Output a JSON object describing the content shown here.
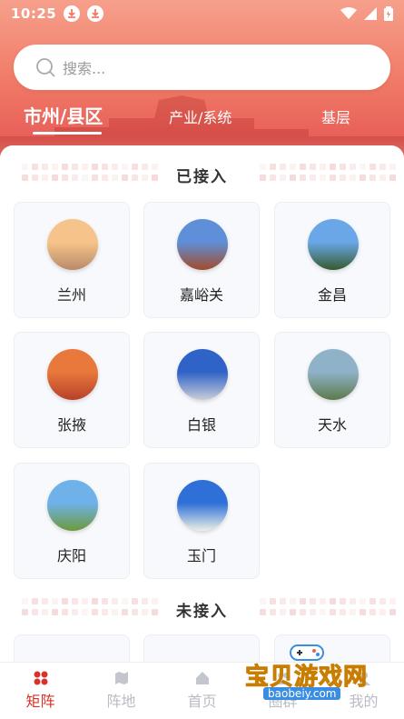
{
  "status_bar": {
    "time": "10:25"
  },
  "search": {
    "placeholder": "搜索..."
  },
  "categories": [
    {
      "label": "市州/县区",
      "active": true
    },
    {
      "label": "产业/系统",
      "active": false
    },
    {
      "label": "基层",
      "active": false
    }
  ],
  "sections": {
    "connected_title": "已接入",
    "unconnected_title": "未接入"
  },
  "cities": [
    {
      "name": "兰州",
      "colors": [
        "#f6c48a",
        "#b98a6a"
      ]
    },
    {
      "name": "嘉峪关",
      "colors": [
        "#5f8fd8",
        "#a14b2a"
      ]
    },
    {
      "name": "金昌",
      "colors": [
        "#6aa7e8",
        "#355a2f"
      ]
    },
    {
      "name": "张掖",
      "colors": [
        "#e8783c",
        "#b8402a"
      ]
    },
    {
      "name": "白银",
      "colors": [
        "#2f63c8",
        "#c8ced8"
      ]
    },
    {
      "name": "天水",
      "colors": [
        "#8fb2c8",
        "#5c7a4b"
      ]
    },
    {
      "name": "庆阳",
      "colors": [
        "#6fb2ea",
        "#6c9a3c"
      ]
    },
    {
      "name": "玉门",
      "colors": [
        "#2e6fd8",
        "#e9efe6"
      ]
    }
  ],
  "bottom_nav": [
    {
      "label": "矩阵",
      "icon": "grid-dots-icon",
      "active": true
    },
    {
      "label": "阵地",
      "icon": "map-icon",
      "active": false
    },
    {
      "label": "首页",
      "icon": "home-icon",
      "active": false
    },
    {
      "label": "圈群",
      "icon": "people-icon",
      "active": false
    },
    {
      "label": "我的",
      "icon": "user-icon",
      "active": false
    }
  ],
  "watermark": {
    "title": "宝贝游戏网",
    "url": "baobeiy.com"
  },
  "colors": {
    "accent": "#d7332b",
    "inactive": "#b9bcc4"
  }
}
